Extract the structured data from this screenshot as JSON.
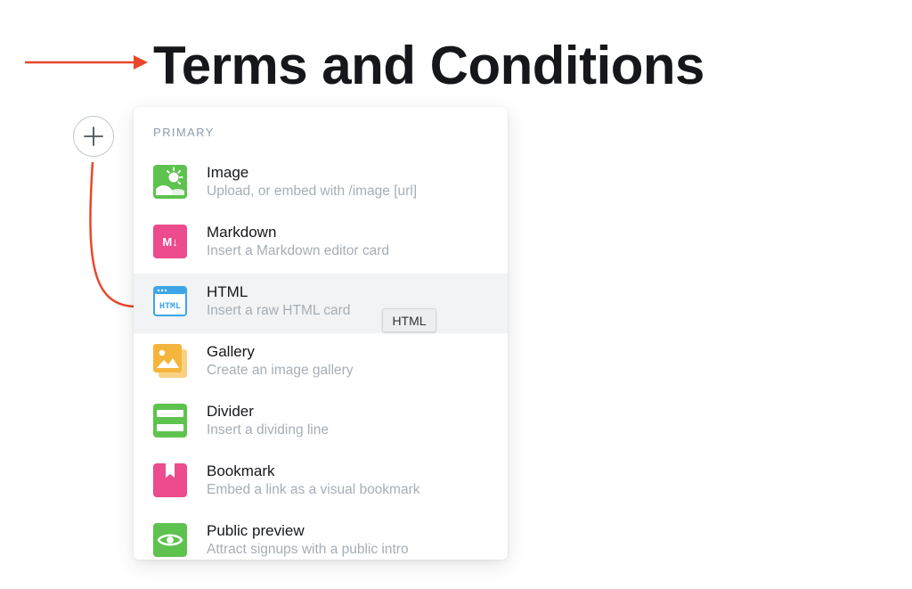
{
  "page": {
    "title": "Terms and Conditions"
  },
  "menu": {
    "section_label": "PRIMARY",
    "items": [
      {
        "name": "Image",
        "description": "Upload, or embed with /image [url]",
        "icon": "image-icon",
        "color": "#5dc34e"
      },
      {
        "name": "Markdown",
        "description": "Insert a Markdown editor card",
        "icon": "markdown-icon",
        "color": "#ec4b8d",
        "icon_text": "M↓"
      },
      {
        "name": "HTML",
        "description": "Insert a raw HTML card",
        "icon": "html-icon",
        "color": "#3ea6e6",
        "icon_text": "HTML",
        "active": true
      },
      {
        "name": "Gallery",
        "description": "Create an image gallery",
        "icon": "gallery-icon",
        "color": "#f5b53d"
      },
      {
        "name": "Divider",
        "description": "Insert a dividing line",
        "icon": "divider-icon",
        "color": "#5dc34e"
      },
      {
        "name": "Bookmark",
        "description": "Embed a link as a visual bookmark",
        "icon": "bookmark-icon",
        "color": "#ec4b8d"
      },
      {
        "name": "Public preview",
        "description": "Attract signups with a public intro",
        "icon": "eye-icon",
        "color": "#5dc34e"
      }
    ]
  },
  "tooltip": {
    "text": "HTML"
  },
  "annotation": {
    "arrow_color": "#e8472c"
  }
}
